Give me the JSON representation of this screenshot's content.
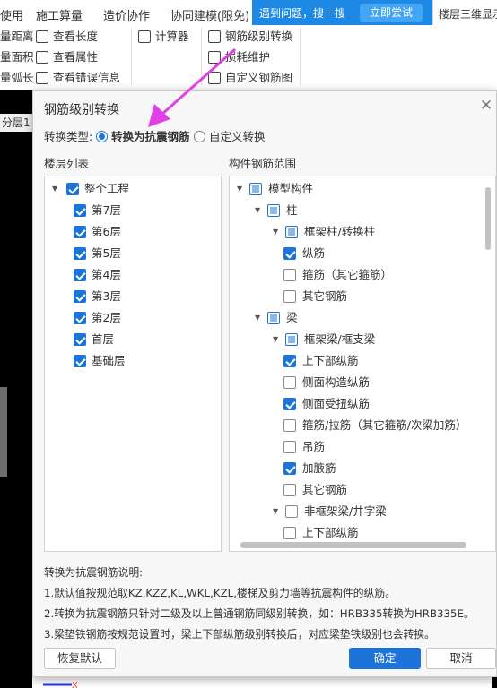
{
  "menubar": {
    "items": [
      "使用",
      "施工算量",
      "造价协作",
      "协同建模(限免)"
    ],
    "promo_text": "遇到问题，搜一搜",
    "promo_button": "立即尝试",
    "active_tab": "楼层三维显示"
  },
  "ribbon": {
    "col1": [
      "量距离",
      "量面积",
      "量弧长"
    ],
    "col2": [
      "查看长度",
      "查看属性",
      "查看错误信息"
    ],
    "col3": [
      "计算器"
    ],
    "col4": [
      "钢筋级别转换",
      "损耗维护",
      "自定义钢筋图"
    ]
  },
  "canvas": {
    "floor_tab": "分层1"
  },
  "dialog": {
    "title": "钢筋级别转换",
    "convert_type_label": "转换类型:",
    "option_seismic": "转换为抗震钢筋",
    "option_custom": "自定义转换",
    "selected_option": "转换为抗震钢筋",
    "floor_list_label": "楼层列表",
    "component_range_label": "构件钢筋范围",
    "floors": [
      {
        "label": "整个工程",
        "checked": true,
        "root": true
      },
      {
        "label": "第7层",
        "checked": true
      },
      {
        "label": "第6层",
        "checked": true
      },
      {
        "label": "第5层",
        "checked": true
      },
      {
        "label": "第4层",
        "checked": true
      },
      {
        "label": "第3层",
        "checked": true
      },
      {
        "label": "第2层",
        "checked": true
      },
      {
        "label": "首层",
        "checked": true
      },
      {
        "label": "基础层",
        "checked": true
      }
    ],
    "components": [
      {
        "label": "模型构件",
        "state": "partial",
        "level": 0,
        "expand": true
      },
      {
        "label": "柱",
        "state": "partial",
        "level": 1,
        "expand": true
      },
      {
        "label": "框架柱/转换柱",
        "state": "partial",
        "level": 2,
        "expand": true
      },
      {
        "label": "纵筋",
        "state": "checked",
        "level": 3
      },
      {
        "label": "箍筋（其它箍筋）",
        "state": "unchecked",
        "level": 3
      },
      {
        "label": "其它钢筋",
        "state": "unchecked",
        "level": 3
      },
      {
        "label": "梁",
        "state": "partial",
        "level": 1,
        "expand": true
      },
      {
        "label": "框架梁/框支梁",
        "state": "partial",
        "level": 2,
        "expand": true
      },
      {
        "label": "上下部纵筋",
        "state": "checked",
        "level": 3
      },
      {
        "label": "侧面构造纵筋",
        "state": "unchecked",
        "level": 3
      },
      {
        "label": "侧面受扭纵筋",
        "state": "checked",
        "level": 3
      },
      {
        "label": "箍筋/拉筋（其它箍筋/次梁加筋）",
        "state": "unchecked",
        "level": 3
      },
      {
        "label": "吊筋",
        "state": "unchecked",
        "level": 3
      },
      {
        "label": "加腋筋",
        "state": "checked",
        "level": 3
      },
      {
        "label": "其它钢筋",
        "state": "unchecked",
        "level": 3
      },
      {
        "label": "非框架梁/井字梁",
        "state": "unchecked",
        "level": 2,
        "expand": true
      },
      {
        "label": "上下部纵筋",
        "state": "unchecked",
        "level": 3
      }
    ],
    "notes": [
      "转换为抗震钢筋说明:",
      "1.默认值按规范取KZ,KZZ,KL,WKL,KZL,楼梯及剪力墙等抗震构件的纵筋。",
      "2.转换为抗震钢筋只针对二级及以上普通钢筋同级别转换，如：HRB335转换为HRB335E。",
      "3.梁垫铁钢筋按规范设置时，梁上下部纵筋级别转换后，对应梁垫铁级别也会转换。"
    ],
    "btn_reset": "恢复默认",
    "btn_ok": "确定",
    "btn_cancel": "取消"
  },
  "colors": {
    "accent": "#1e73d8",
    "promo": "#1e88e5",
    "annotation_arrow": "#e040e6"
  }
}
